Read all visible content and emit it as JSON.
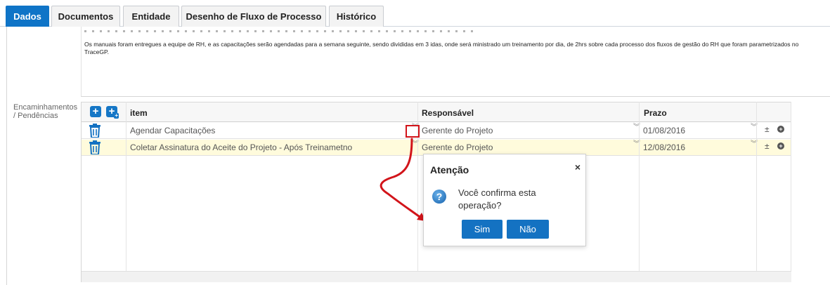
{
  "tabs": [
    {
      "label": "Dados",
      "active": true
    },
    {
      "label": "Documentos",
      "active": false
    },
    {
      "label": "Entidade",
      "active": false
    },
    {
      "label": "Desenho de Fluxo de Processo",
      "active": false
    },
    {
      "label": "Histórico",
      "active": false
    }
  ],
  "description": {
    "text": "Os manuais foram entregues a equipe de RH, e as capacitações serão agendadas para a semana seguinte, sendo divididas em 3 idas, onde será ministrado um treinamento por dia, de 2hrs sobre cada processo dos fluxos de gestão do RH que foram parametrizados no TraceGP."
  },
  "section_label": "Encaminhamentos / Pendências",
  "grid": {
    "headers": {
      "item": "item",
      "responsavel": "Responsável",
      "prazo": "Prazo"
    },
    "rows": [
      {
        "item": "Agendar Capacitações",
        "responsavel": "Gerente do Projeto",
        "prazo": "01/08/2016",
        "selected": false
      },
      {
        "item": "Coletar Assinatura do Aceite do Projeto - Após Treinametno",
        "responsavel": "Gerente do Projeto",
        "prazo": "12/08/2016",
        "selected": true
      }
    ]
  },
  "dialog": {
    "title": "Atenção",
    "message": "Você confirma esta operação?",
    "confirm": "Sim",
    "cancel": "Não"
  },
  "colors": {
    "accent": "#0f74c7",
    "annotation": "#d2141a",
    "selected_row": "#fffbdc"
  }
}
